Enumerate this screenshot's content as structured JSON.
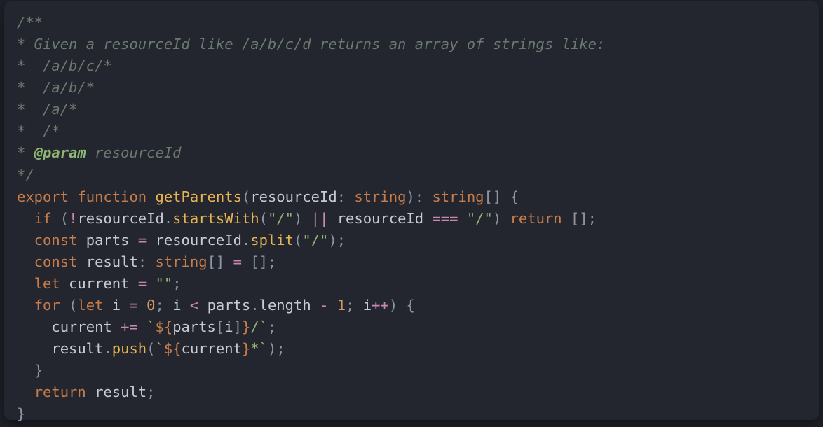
{
  "comment": {
    "l1": "/**",
    "l2": "* Given a resourceId like /a/b/c/d returns an array of strings like:",
    "l3": "*  /a/b/c/*",
    "l4": "*  /a/b/*",
    "l5": "*  /a/*",
    "l6": "*  /*",
    "l7_star": "* ",
    "l7_param": "@param",
    "l7_name": " resourceId",
    "l8": "*/"
  },
  "kw": {
    "export": "export",
    "function": "function",
    "if": "if",
    "return": "return",
    "const": "const",
    "let": "let",
    "for": "for",
    "string": "string"
  },
  "fn": {
    "getParents": "getParents",
    "startsWith": "startsWith",
    "split": "split",
    "push": "push"
  },
  "id": {
    "resourceId": "resourceId",
    "parts": "parts",
    "result": "result",
    "current": "current",
    "i": "i",
    "length": "length"
  },
  "str": {
    "slash": "\"/\"",
    "empty": "\"\"",
    "bt1": "`",
    "dollar_open": "${",
    "close_brace": "}",
    "slash_bt": "/`",
    "star_bt": "*`"
  },
  "num": {
    "zero": "0",
    "one": "1"
  },
  "op": {
    "not": "!",
    "or": "||",
    "seq": "===",
    "eq": "=",
    "lt": "<",
    "minus": "-",
    "inc": "++",
    "peq": "+="
  },
  "pn": {
    "lparen": "(",
    "rparen": ")",
    "lbrace": "{",
    "rbrace": "}",
    "lbrack": "[",
    "rbrack": "]",
    "colon": ":",
    "semi": ";",
    "dot": ".",
    "comma": ","
  },
  "sp": {
    "s1": " ",
    "s2": "  ",
    "s4": "    "
  }
}
